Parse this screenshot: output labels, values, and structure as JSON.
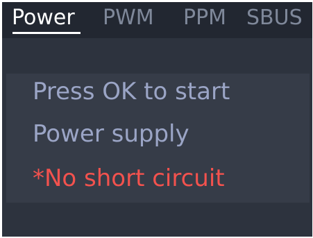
{
  "tabs": [
    {
      "label": "Power",
      "active": true
    },
    {
      "label": "PWM",
      "active": false
    },
    {
      "label": "PPM",
      "active": false
    },
    {
      "label": "SBUS",
      "active": false
    }
  ],
  "panel": {
    "lines": [
      "Press OK to start",
      "Power supply",
      "*No short circuit"
    ]
  },
  "colors": {
    "background": "#2d333e",
    "tabbar": "#222731",
    "panel": "#363c48",
    "tab_active": "#ffffff",
    "tab_inactive": "#7f889a",
    "info_text": "#9ba5c6",
    "warning_text": "#f3524e"
  }
}
